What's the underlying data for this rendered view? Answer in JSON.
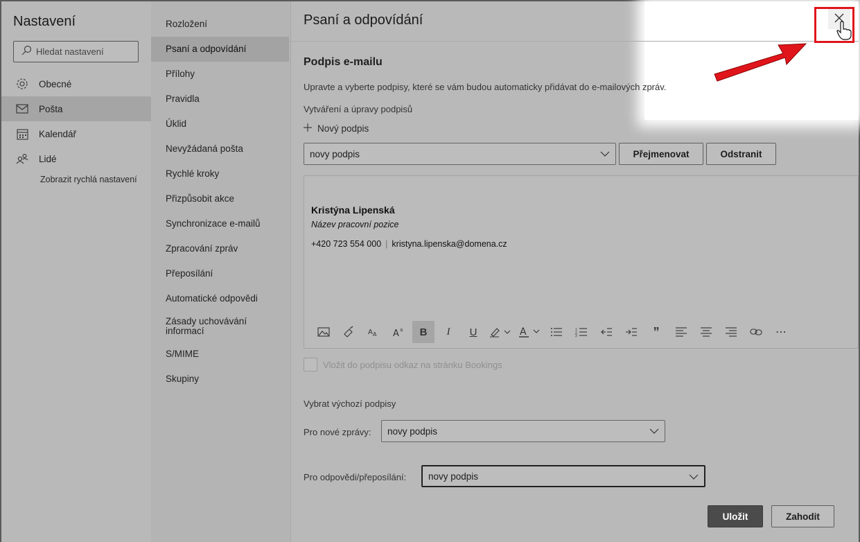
{
  "nav": {
    "title": "Nastavení",
    "search_placeholder": "Hledat nastavení",
    "items": [
      {
        "label": "Obecné",
        "icon": "gear-icon"
      },
      {
        "label": "Pošta",
        "icon": "mail-icon"
      },
      {
        "label": "Kalendář",
        "icon": "calendar-icon"
      },
      {
        "label": "Lidé",
        "icon": "people-icon"
      }
    ],
    "quick_settings": "Zobrazit rychlá nastavení"
  },
  "mail_menu": {
    "items": [
      {
        "label": "Rozložení"
      },
      {
        "label": "Psaní a odpovídání"
      },
      {
        "label": "Přílohy"
      },
      {
        "label": "Pravidla"
      },
      {
        "label": "Úklid"
      },
      {
        "label": "Nevyžádaná pošta"
      },
      {
        "label": "Rychlé kroky"
      },
      {
        "label": "Přizpůsobit akce"
      },
      {
        "label": "Synchronizace e-mailů"
      },
      {
        "label": "Zpracování zpráv"
      },
      {
        "label": "Přeposílání"
      },
      {
        "label": "Automatické odpovědi"
      },
      {
        "label": "Zásady uchovávání informací"
      },
      {
        "label": "S/MIME"
      },
      {
        "label": "Skupiny"
      }
    ]
  },
  "main": {
    "title": "Psaní a odpovídání",
    "signature_section": {
      "title": "Podpis e-mailu",
      "description": "Upravte a vyberte podpisy, které se vám budou automaticky přidávat do e-mailových zpráv.",
      "create_label": "Vytváření a úpravy podpisů",
      "new_signature": "Nový podpis",
      "selected_signature": "novy podpis",
      "rename_button": "Přejmenovat",
      "delete_button": "Odstranit"
    },
    "signature": {
      "name": "Kristýna Lipenská",
      "role": "Název pracovní pozice",
      "phone": "+420 723 554 000",
      "separator": "|",
      "email": "kristyna.lipenska@domena.cz"
    },
    "toolbar": {
      "bold": "B",
      "italic": "I",
      "underline": "U",
      "font_color": "A",
      "font_size": "A",
      "quote": "”",
      "more": "⋯"
    },
    "bookings_checkbox": "Vložit do podpisu odkaz na stránku Bookings",
    "defaults": {
      "title": "Vybrat výchozí podpisy",
      "new_messages_label": "Pro nové zprávy:",
      "new_messages_value": "novy podpis",
      "replies_label": "Pro odpovědi/přeposílání:",
      "replies_value": "novy podpis"
    },
    "save_button": "Uložit",
    "discard_button": "Zahodit"
  },
  "colors": {
    "highlight_box": "#e0151b",
    "arrow": "#e0151b",
    "save_button_bg": "#4b4b4b"
  }
}
